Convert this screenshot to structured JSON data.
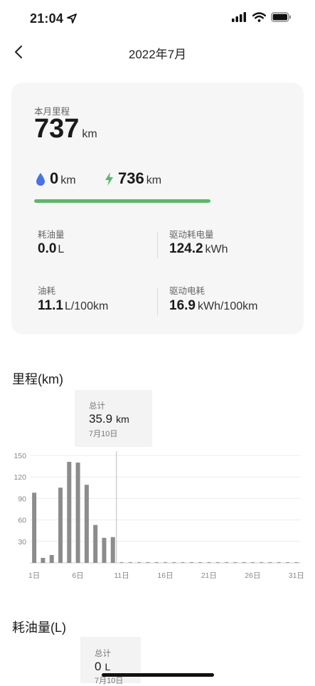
{
  "status_bar": {
    "time": "21:04"
  },
  "nav": {
    "title": "2022年7月"
  },
  "summary": {
    "mileage_label": "本月里程",
    "mileage_value": "737",
    "mileage_unit": "km",
    "fuel_km_value": "0",
    "fuel_km_unit": "km",
    "electric_km_value": "736",
    "electric_km_unit": "km",
    "electric_share": 1.0,
    "stats": [
      {
        "label": "耗油量",
        "value": "0.0",
        "unit": "L"
      },
      {
        "label": "驱动耗电量",
        "value": "124.2",
        "unit": "kWh"
      },
      {
        "label": "油耗",
        "value": "11.1",
        "unit": "L/100km"
      },
      {
        "label": "驱动电耗",
        "value": "16.9",
        "unit": "kWh/100km"
      }
    ]
  },
  "mileage_section": {
    "title": "里程(km)",
    "tooltip": {
      "label": "总计",
      "value": "35.9",
      "unit": "km",
      "date": "7月10日"
    }
  },
  "fuel_section": {
    "title": "耗油量(L)",
    "tooltip": {
      "label": "总计",
      "value": "0",
      "unit": "L",
      "date": "7月10日"
    }
  },
  "colors": {
    "accent_green": "#5bb86a",
    "drop_blue": "#4a72e0",
    "bar_gray": "#8c8c8c"
  },
  "chart_data": {
    "type": "bar",
    "title": "里程(km)",
    "x": [
      1,
      2,
      3,
      4,
      5,
      6,
      7,
      8,
      9,
      10,
      11,
      12,
      13,
      14,
      15,
      16,
      17,
      18,
      19,
      20,
      21,
      22,
      23,
      24,
      25,
      26,
      27,
      28,
      29,
      30,
      31
    ],
    "values": [
      98,
      7,
      11,
      105,
      141,
      140,
      109,
      53,
      35,
      36,
      0,
      0,
      0,
      0,
      0,
      0,
      0,
      0,
      0,
      0,
      0,
      0,
      0,
      0,
      0,
      0,
      0,
      0,
      0,
      0,
      0
    ],
    "x_tick_labels": [
      "1日",
      "6日",
      "11日",
      "16日",
      "21日",
      "26日",
      "31日"
    ],
    "x_tick_days": [
      1,
      6,
      11,
      16,
      21,
      26,
      31
    ],
    "y_ticks": [
      "150",
      "120",
      "90",
      "60",
      "30"
    ],
    "y_tick_values": [
      150,
      120,
      90,
      60,
      30
    ],
    "ylim": [
      0,
      150
    ],
    "selected_day": 10,
    "grid": true
  }
}
